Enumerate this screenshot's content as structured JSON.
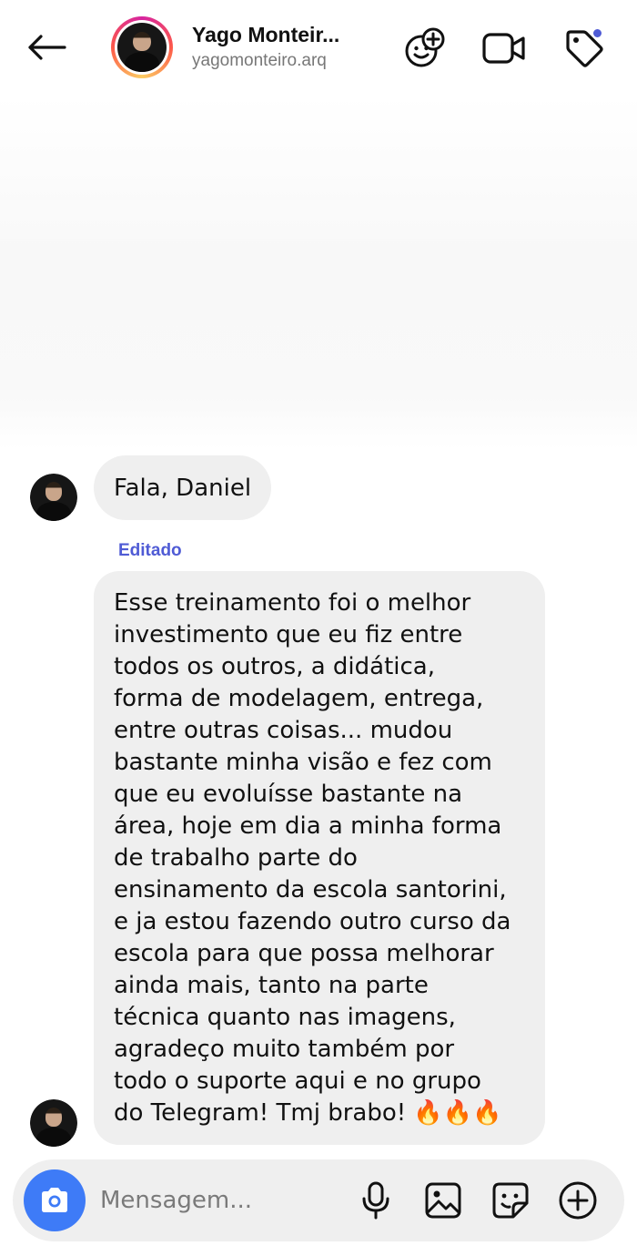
{
  "header": {
    "name": "Yago Monteir...",
    "username": "yagomonteiro.arq",
    "back_icon": "arrow-left-icon",
    "icons": [
      "add-friend-sticker-icon",
      "video-call-icon",
      "tag-icon"
    ],
    "notification_dot_color": "#4f5bd5"
  },
  "messages": [
    {
      "text": "Fala, Daniel",
      "edited": false
    },
    {
      "edited_label": "Editado",
      "lines": [
        "Esse treinamento foi o melhor",
        "investimento que eu fiz entre",
        "todos os outros, a didática,",
        "forma de modelagem, entrega,",
        "entre outras coisas... mudou",
        "bastante minha visão e fez com",
        "que eu evoluísse bastante na",
        "área, hoje em dia a minha forma",
        "de trabalho parte do",
        "ensinamento da escola santorini,",
        "e ja estou fazendo outro curso da",
        "escola para que possa melhorar",
        "ainda mais, tanto na parte",
        "técnica quanto nas imagens,",
        "agradeço muito também por",
        "todo o suporte aqui e no grupo",
        "do Telegram! Tmj brabo! 🔥🔥🔥"
      ]
    }
  ],
  "composer": {
    "placeholder": "Mensagem...",
    "camera_color": "#3e7bf7",
    "icons": [
      "microphone-icon",
      "gallery-icon",
      "sticker-icon",
      "plus-circle-icon"
    ]
  },
  "colors": {
    "bubble": "#efefef",
    "accent": "#4f5bd5"
  }
}
